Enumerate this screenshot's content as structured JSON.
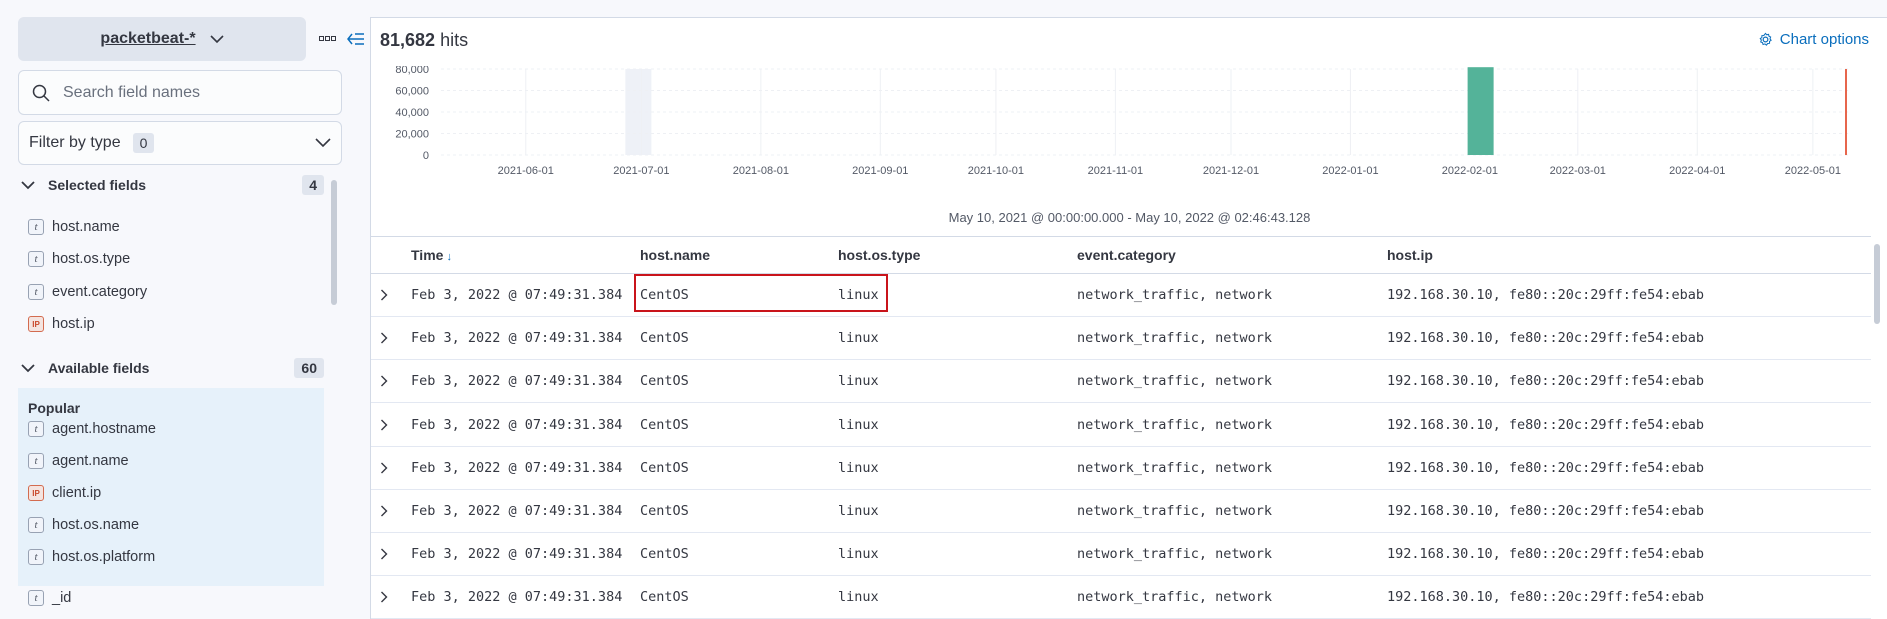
{
  "sidebar": {
    "index_pattern": "packetbeat-*",
    "search_placeholder": "Search field names",
    "filter_label": "Filter by type",
    "filter_count": "0",
    "selected": {
      "title": "Selected fields",
      "count": "4",
      "fields": [
        {
          "name": "host.name",
          "type": "t"
        },
        {
          "name": "host.os.type",
          "type": "t"
        },
        {
          "name": "event.category",
          "type": "t"
        },
        {
          "name": "host.ip",
          "type": "IP"
        }
      ]
    },
    "available": {
      "title": "Available fields",
      "count": "60",
      "popular_title": "Popular",
      "popular": [
        {
          "name": "agent.hostname",
          "type": "t"
        },
        {
          "name": "agent.name",
          "type": "t"
        },
        {
          "name": "client.ip",
          "type": "IP"
        },
        {
          "name": "host.os.name",
          "type": "t"
        },
        {
          "name": "host.os.platform",
          "type": "t"
        }
      ],
      "others": [
        {
          "name": "_id",
          "type": "t"
        }
      ]
    }
  },
  "main": {
    "hits_count": "81,682",
    "hits_label": "hits",
    "chart_options_label": "Chart options",
    "time_range": "May 10, 2021 @ 00:00:00.000 - May 10, 2022 @ 02:46:43.128"
  },
  "chart_data": {
    "type": "bar",
    "y_ticks": [
      "80,000",
      "60,000",
      "40,000",
      "20,000",
      "0"
    ],
    "x_ticks": [
      "2021-06-01",
      "2021-07-01",
      "2021-08-01",
      "2021-09-01",
      "2021-10-01",
      "2021-11-01",
      "2021-12-01",
      "2022-01-01",
      "2022-02-01",
      "2022-03-01",
      "2022-04-01",
      "2022-05-01"
    ],
    "ylim": [
      0,
      80000
    ],
    "bars": [
      {
        "date": "2022-02-03",
        "value": 81682
      }
    ],
    "bar_color": "#54b399",
    "now_marker_color": "#e7664c",
    "grid": true
  },
  "table": {
    "columns": [
      "Time",
      "host.name",
      "host.os.type",
      "event.category",
      "host.ip"
    ],
    "sort_icon": "↓",
    "rows": [
      {
        "time": "Feb 3, 2022 @ 07:49:31.384",
        "host_name": "CentOS",
        "os_type": "linux",
        "category": "network_traffic, network",
        "ip": "192.168.30.10, fe80::20c:29ff:fe54:ebab"
      },
      {
        "time": "Feb 3, 2022 @ 07:49:31.384",
        "host_name": "CentOS",
        "os_type": "linux",
        "category": "network_traffic, network",
        "ip": "192.168.30.10, fe80::20c:29ff:fe54:ebab"
      },
      {
        "time": "Feb 3, 2022 @ 07:49:31.384",
        "host_name": "CentOS",
        "os_type": "linux",
        "category": "network_traffic, network",
        "ip": "192.168.30.10, fe80::20c:29ff:fe54:ebab"
      },
      {
        "time": "Feb 3, 2022 @ 07:49:31.384",
        "host_name": "CentOS",
        "os_type": "linux",
        "category": "network_traffic, network",
        "ip": "192.168.30.10, fe80::20c:29ff:fe54:ebab"
      },
      {
        "time": "Feb 3, 2022 @ 07:49:31.384",
        "host_name": "CentOS",
        "os_type": "linux",
        "category": "network_traffic, network",
        "ip": "192.168.30.10, fe80::20c:29ff:fe54:ebab"
      },
      {
        "time": "Feb 3, 2022 @ 07:49:31.384",
        "host_name": "CentOS",
        "os_type": "linux",
        "category": "network_traffic, network",
        "ip": "192.168.30.10, fe80::20c:29ff:fe54:ebab"
      },
      {
        "time": "Feb 3, 2022 @ 07:49:31.384",
        "host_name": "CentOS",
        "os_type": "linux",
        "category": "network_traffic, network",
        "ip": "192.168.30.10, fe80::20c:29ff:fe54:ebab"
      },
      {
        "time": "Feb 3, 2022 @ 07:49:31.384",
        "host_name": "CentOS",
        "os_type": "linux",
        "category": "network_traffic, network",
        "ip": "192.168.30.10, fe80::20c:29ff:fe54:ebab"
      }
    ]
  }
}
